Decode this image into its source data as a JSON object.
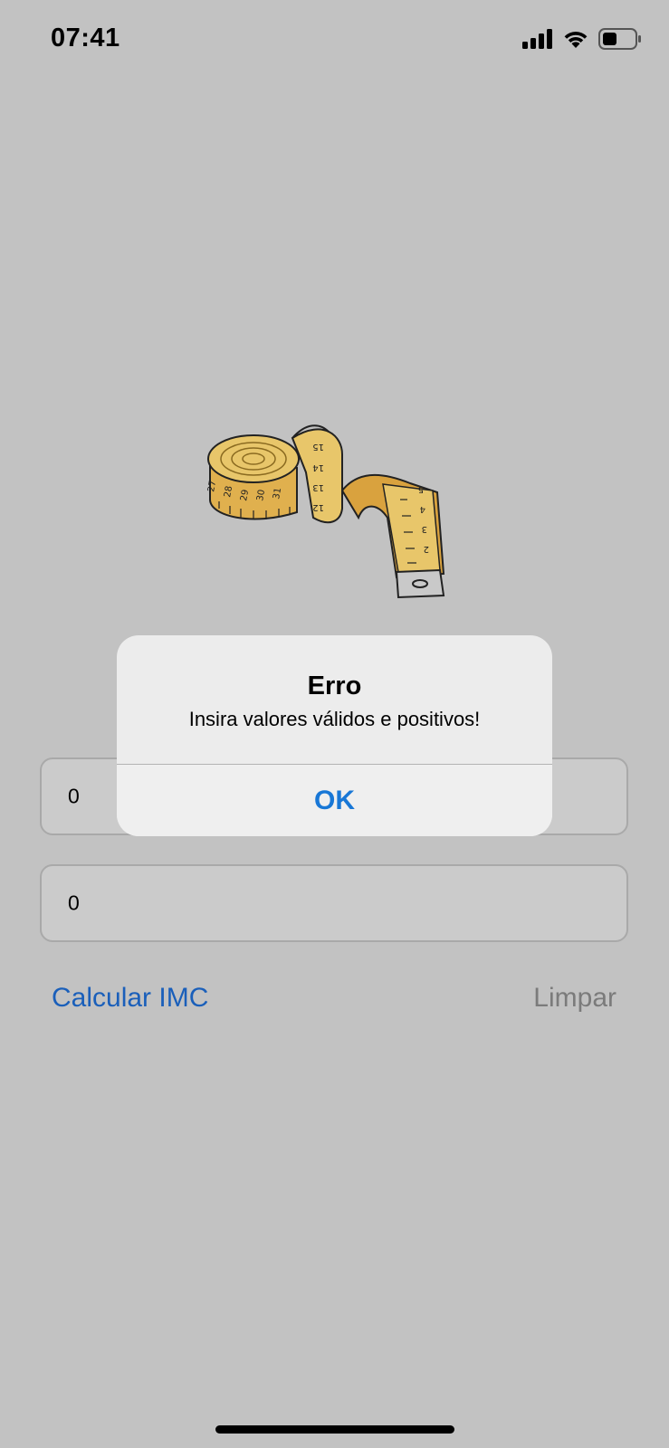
{
  "status_bar": {
    "time": "07:41",
    "icons": [
      "signal-icon",
      "wifi-icon",
      "battery-icon"
    ]
  },
  "illustration": {
    "icon": "measuring-tape-icon",
    "tape_numbers_left": [
      "27",
      "28",
      "29",
      "30",
      "31"
    ],
    "tape_numbers_middle": [
      "15",
      "14",
      "13",
      "12"
    ],
    "tape_numbers_right": [
      "5",
      "4",
      "3",
      "2"
    ]
  },
  "form": {
    "weight_value": "0",
    "height_value": "0"
  },
  "actions": {
    "calculate_label": "Calcular IMC",
    "clear_label": "Limpar"
  },
  "alert": {
    "title": "Erro",
    "message": "Insira valores válidos e positivos!",
    "ok_label": "OK"
  },
  "colors": {
    "background": "#c2c2c2",
    "accent": "#1a5fba",
    "alert_button": "#1877d6",
    "disabled": "#7b7b7b"
  }
}
